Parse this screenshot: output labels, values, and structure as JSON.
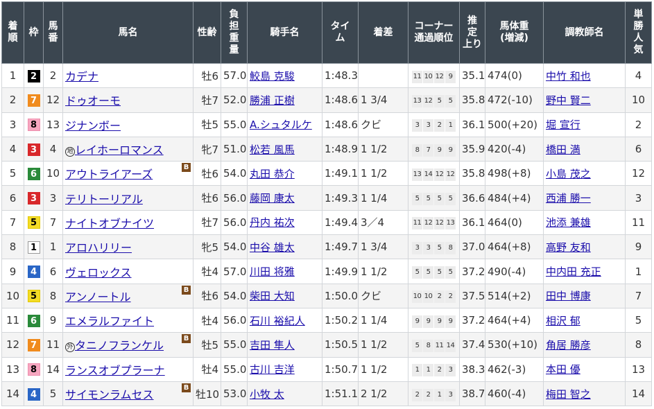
{
  "headers": [
    [
      "着",
      "順"
    ],
    [
      "枠"
    ],
    [
      "馬",
      "番"
    ],
    [
      "馬名"
    ],
    [
      "性齢"
    ],
    [
      "負",
      "担",
      "重",
      "量"
    ],
    [
      "騎手名"
    ],
    [
      "タイ",
      "ム"
    ],
    [
      "着差"
    ],
    [
      "コーナー",
      "通過順位"
    ],
    [
      "推",
      "定",
      "上り"
    ],
    [
      "馬体重",
      "(増減)"
    ],
    [
      "調教師名"
    ],
    [
      "単",
      "勝",
      "人",
      "気"
    ]
  ],
  "rows": [
    {
      "rank": "1",
      "waku": "2",
      "num": "2",
      "horse": "カデナ",
      "mark": "",
      "blinker": false,
      "sex_age": "牡6",
      "weight": "57.0",
      "jockey": "鮫島 克駿",
      "time": "1:48.3",
      "margin": "",
      "corners": [
        "11",
        "10",
        "12",
        "9"
      ],
      "last3f": "35.1",
      "body": "474(0)",
      "trainer": "中竹 和也",
      "pop": "4"
    },
    {
      "rank": "2",
      "waku": "7",
      "num": "12",
      "horse": "ドゥオーモ",
      "mark": "",
      "blinker": false,
      "sex_age": "牡7",
      "weight": "52.0",
      "jockey": "勝浦 正樹",
      "time": "1:48.6",
      "margin": "1 3/4",
      "corners": [
        "13",
        "12",
        "5",
        "5"
      ],
      "last3f": "35.8",
      "body": "472(-10)",
      "trainer": "野中 賢二",
      "pop": "10"
    },
    {
      "rank": "3",
      "waku": "8",
      "num": "13",
      "horse": "ジナンボー",
      "mark": "",
      "blinker": false,
      "sex_age": "牡5",
      "weight": "55.0",
      "jockey": "A.シュタルケ",
      "time": "1:48.6",
      "margin": "クビ",
      "corners": [
        "3",
        "3",
        "2",
        "1"
      ],
      "last3f": "36.1",
      "body": "500(+20)",
      "trainer": "堀 宣行",
      "pop": "2"
    },
    {
      "rank": "4",
      "waku": "3",
      "num": "4",
      "horse": "レイホーロマンス",
      "mark": "地",
      "blinker": false,
      "sex_age": "牝7",
      "weight": "51.0",
      "jockey": "松若 風馬",
      "time": "1:48.9",
      "margin": "1 1/2",
      "corners": [
        "8",
        "7",
        "9",
        "9"
      ],
      "last3f": "35.9",
      "body": "420(-4)",
      "trainer": "橋田 満",
      "pop": "6"
    },
    {
      "rank": "5",
      "waku": "6",
      "num": "10",
      "horse": "アウトライアーズ",
      "mark": "",
      "blinker": true,
      "sex_age": "牡6",
      "weight": "54.0",
      "jockey": "丸田 恭介",
      "time": "1:49.1",
      "margin": "1 1/2",
      "corners": [
        "13",
        "14",
        "12",
        "12"
      ],
      "last3f": "35.8",
      "body": "498(+8)",
      "trainer": "小島 茂之",
      "pop": "12"
    },
    {
      "rank": "6",
      "waku": "3",
      "num": "3",
      "horse": "テリトーリアル",
      "mark": "",
      "blinker": false,
      "sex_age": "牡6",
      "weight": "56.0",
      "jockey": "藤岡 康太",
      "time": "1:49.3",
      "margin": "1 1/4",
      "corners": [
        "5",
        "5",
        "5",
        "5"
      ],
      "last3f": "36.6",
      "body": "484(+4)",
      "trainer": "西浦 勝一",
      "pop": "3"
    },
    {
      "rank": "7",
      "waku": "5",
      "num": "7",
      "horse": "ナイトオブナイツ",
      "mark": "",
      "blinker": false,
      "sex_age": "牡7",
      "weight": "56.0",
      "jockey": "丹内 祐次",
      "time": "1:49.4",
      "margin": "3／4",
      "corners": [
        "11",
        "12",
        "12",
        "13"
      ],
      "last3f": "36.1",
      "body": "464(0)",
      "trainer": "池添 兼雄",
      "pop": "11"
    },
    {
      "rank": "8",
      "waku": "1",
      "num": "1",
      "horse": "アロハリリー",
      "mark": "",
      "blinker": false,
      "sex_age": "牝5",
      "weight": "54.0",
      "jockey": "中谷 雄太",
      "time": "1:49.7",
      "margin": "1 3/4",
      "corners": [
        "3",
        "3",
        "5",
        "8"
      ],
      "last3f": "37.0",
      "body": "464(+8)",
      "trainer": "高野 友和",
      "pop": "9"
    },
    {
      "rank": "9",
      "waku": "4",
      "num": "6",
      "horse": "ヴェロックス",
      "mark": "",
      "blinker": false,
      "sex_age": "牡4",
      "weight": "57.0",
      "jockey": "川田 将雅",
      "time": "1:49.9",
      "margin": "1 1/2",
      "corners": [
        "5",
        "5",
        "5",
        "5"
      ],
      "last3f": "37.2",
      "body": "490(-4)",
      "trainer": "中内田 充正",
      "pop": "1"
    },
    {
      "rank": "10",
      "waku": "5",
      "num": "8",
      "horse": "アンノートル",
      "mark": "",
      "blinker": true,
      "sex_age": "牡6",
      "weight": "54.0",
      "jockey": "柴田 大知",
      "time": "1:50.0",
      "margin": "クビ",
      "corners": [
        "10",
        "10",
        "2",
        "2"
      ],
      "last3f": "37.5",
      "body": "514(+2)",
      "trainer": "田中 博康",
      "pop": "7"
    },
    {
      "rank": "11",
      "waku": "6",
      "num": "9",
      "horse": "エメラルファイト",
      "mark": "",
      "blinker": false,
      "sex_age": "牡4",
      "weight": "56.0",
      "jockey": "石川 裕紀人",
      "time": "1:50.2",
      "margin": "1 1/4",
      "corners": [
        "9",
        "9",
        "9",
        "9"
      ],
      "last3f": "37.2",
      "body": "464(+4)",
      "trainer": "相沢 郁",
      "pop": "5"
    },
    {
      "rank": "12",
      "waku": "7",
      "num": "11",
      "horse": "タニノフランケル",
      "mark": "外",
      "blinker": true,
      "sex_age": "牡5",
      "weight": "55.0",
      "jockey": "吉田 隼人",
      "time": "1:50.5",
      "margin": "1 1/2",
      "corners": [
        "5",
        "8",
        "11",
        "14"
      ],
      "last3f": "37.4",
      "body": "530(+10)",
      "trainer": "角居 勝彦",
      "pop": "8"
    },
    {
      "rank": "13",
      "waku": "8",
      "num": "14",
      "horse": "ランスオブプラーナ",
      "mark": "",
      "blinker": false,
      "sex_age": "牡4",
      "weight": "55.0",
      "jockey": "古川 吉洋",
      "time": "1:50.7",
      "margin": "1 1/2",
      "corners": [
        "1",
        "1",
        "2",
        "3"
      ],
      "last3f": "38.3",
      "body": "462(-3)",
      "trainer": "本田 優",
      "pop": "13"
    },
    {
      "rank": "14",
      "waku": "4",
      "num": "5",
      "horse": "サイモンラムセス",
      "mark": "",
      "blinker": true,
      "sex_age": "牡10",
      "weight": "53.0",
      "jockey": "小牧 太",
      "time": "1:51.1",
      "margin": "2 1/2",
      "corners": [
        "2",
        "2",
        "1",
        "3"
      ],
      "last3f": "38.7",
      "body": "460(-4)",
      "trainer": "梅田 智之",
      "pop": "14"
    }
  ],
  "blinker_label": "B",
  "colors": {
    "header_bg": "#3b4650",
    "link": "#1a0dab",
    "blinker_bg": "#7b4a1c"
  }
}
